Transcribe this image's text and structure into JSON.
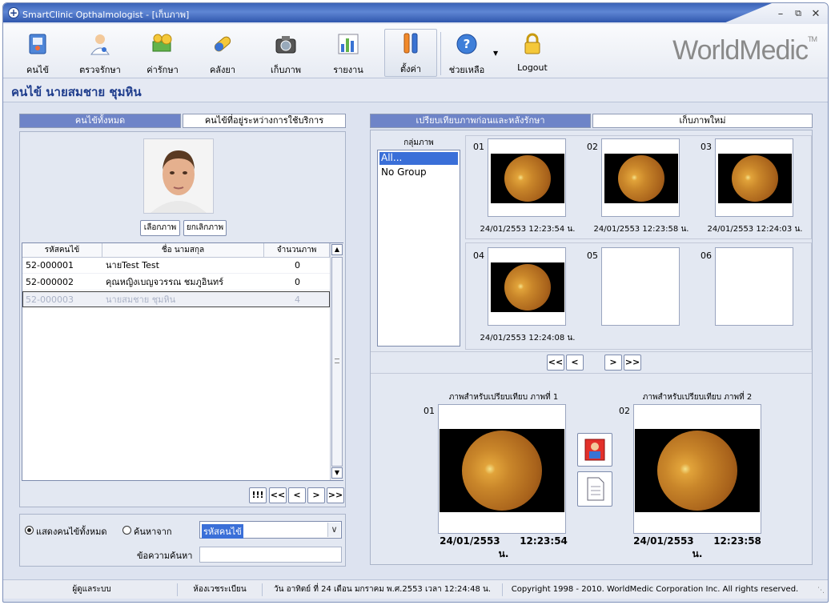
{
  "window": {
    "title": "SmartClinic Opthalmologist - [เก็บภาพ]"
  },
  "toolbar": {
    "items": [
      {
        "label": "คนไข้",
        "icon": "patient-book-icon"
      },
      {
        "label": "ตรวจรักษา",
        "icon": "doctor-icon"
      },
      {
        "label": "ค่ารักษา",
        "icon": "money-icon"
      },
      {
        "label": "คลังยา",
        "icon": "pill-icon"
      },
      {
        "label": "เก็บภาพ",
        "icon": "camera-icon"
      },
      {
        "label": "รายงาน",
        "icon": "report-chart-icon"
      },
      {
        "label": "ตั้งค่า",
        "icon": "tools-icon"
      },
      {
        "label": "ช่วยเหลือ",
        "icon": "help-icon"
      },
      {
        "label": "Logout",
        "icon": "lock-icon"
      }
    ],
    "logo": "WorldMedic",
    "logo_tm": "TM"
  },
  "patient": {
    "header": "คนไข้  นายสมชาย ชุมหิน"
  },
  "left": {
    "tabs": [
      "คนไข้ทั้งหมด",
      "คนไข้ที่อยู่ระหว่างการใช้บริการ"
    ],
    "select_photo": "เลือกภาพ",
    "cancel_photo": "ยกเลิกภาพ",
    "columns": [
      "รหัสคนไข้",
      "ชื่อ นามสกุล",
      "จำนวนภาพ"
    ],
    "rows": [
      {
        "id": "52-000001",
        "name": "นายTest Test",
        "count": "0"
      },
      {
        "id": "52-000002",
        "name": "คุณหญิงเบญจวรรณ ชมภูอินทร์",
        "count": "0"
      },
      {
        "id": "52-000003",
        "name": "นายสมชาย ชุมหิน",
        "count": "4"
      }
    ],
    "nav": [
      "!!!",
      "<<",
      "<",
      ">",
      ">>"
    ],
    "radio_all": "แสดงคนไข้ทั้งหมด",
    "radio_search": "ค้นหาจาก",
    "search_field_value": "รหัสคนไข้",
    "search_text_label": "ข้อความค้นหา",
    "search_text_value": ""
  },
  "right": {
    "tabs": [
      "เปรียบเทียบภาพก่อนและหลังรักษา",
      "เก็บภาพใหม่"
    ],
    "group_header": "กลุ่มภาพ",
    "groups": [
      "All...",
      "No Group"
    ],
    "thumbs": [
      {
        "num": "01",
        "date": "24/01/2553  12:23:54 น."
      },
      {
        "num": "02",
        "date": "24/01/2553  12:23:58 น."
      },
      {
        "num": "03",
        "date": "24/01/2553  12:24:03 น."
      },
      {
        "num": "04",
        "date": "24/01/2553  12:24:08 น."
      },
      {
        "num": "05",
        "date": ""
      },
      {
        "num": "06",
        "date": ""
      }
    ],
    "nav": [
      "<<",
      "<",
      ">",
      ">>"
    ],
    "compare": [
      {
        "title": "ภาพสำหรับเปรียบเทียบ ภาพที่ 1",
        "num": "01",
        "date": "24/01/2553",
        "time": "12:23:54 น."
      },
      {
        "title": "ภาพสำหรับเปรียบเทียบ ภาพที่ 2",
        "num": "02",
        "date": "24/01/2553",
        "time": "12:23:58 น."
      }
    ]
  },
  "status": {
    "user": "ผู้ดูแลระบบ",
    "room": "ห้องเวชระเบียน",
    "datetime": "วัน อาทิตย์ ที่ 24 เดือน มกราคม พ.ศ.2553 เวลา 12:24:48 น.",
    "copyright": "Copyright 1998 - 2010. WorldMedic Corporation Inc. All rights reserved."
  }
}
